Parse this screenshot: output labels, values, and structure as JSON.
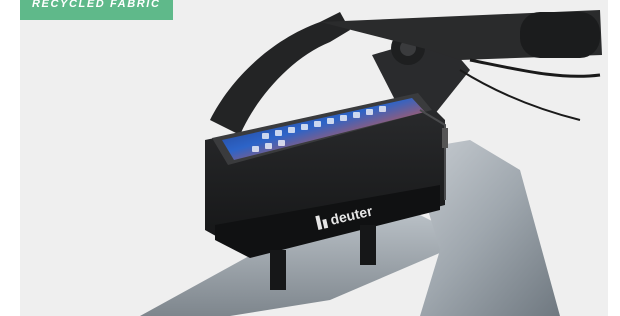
{
  "badge": {
    "label": "RECYCLED FABRIC"
  },
  "product": {
    "brand_logo_text": "deuter",
    "icon": "bike-phone-bag",
    "badge_color": "#5fb98a",
    "background_color": "#efefef"
  }
}
